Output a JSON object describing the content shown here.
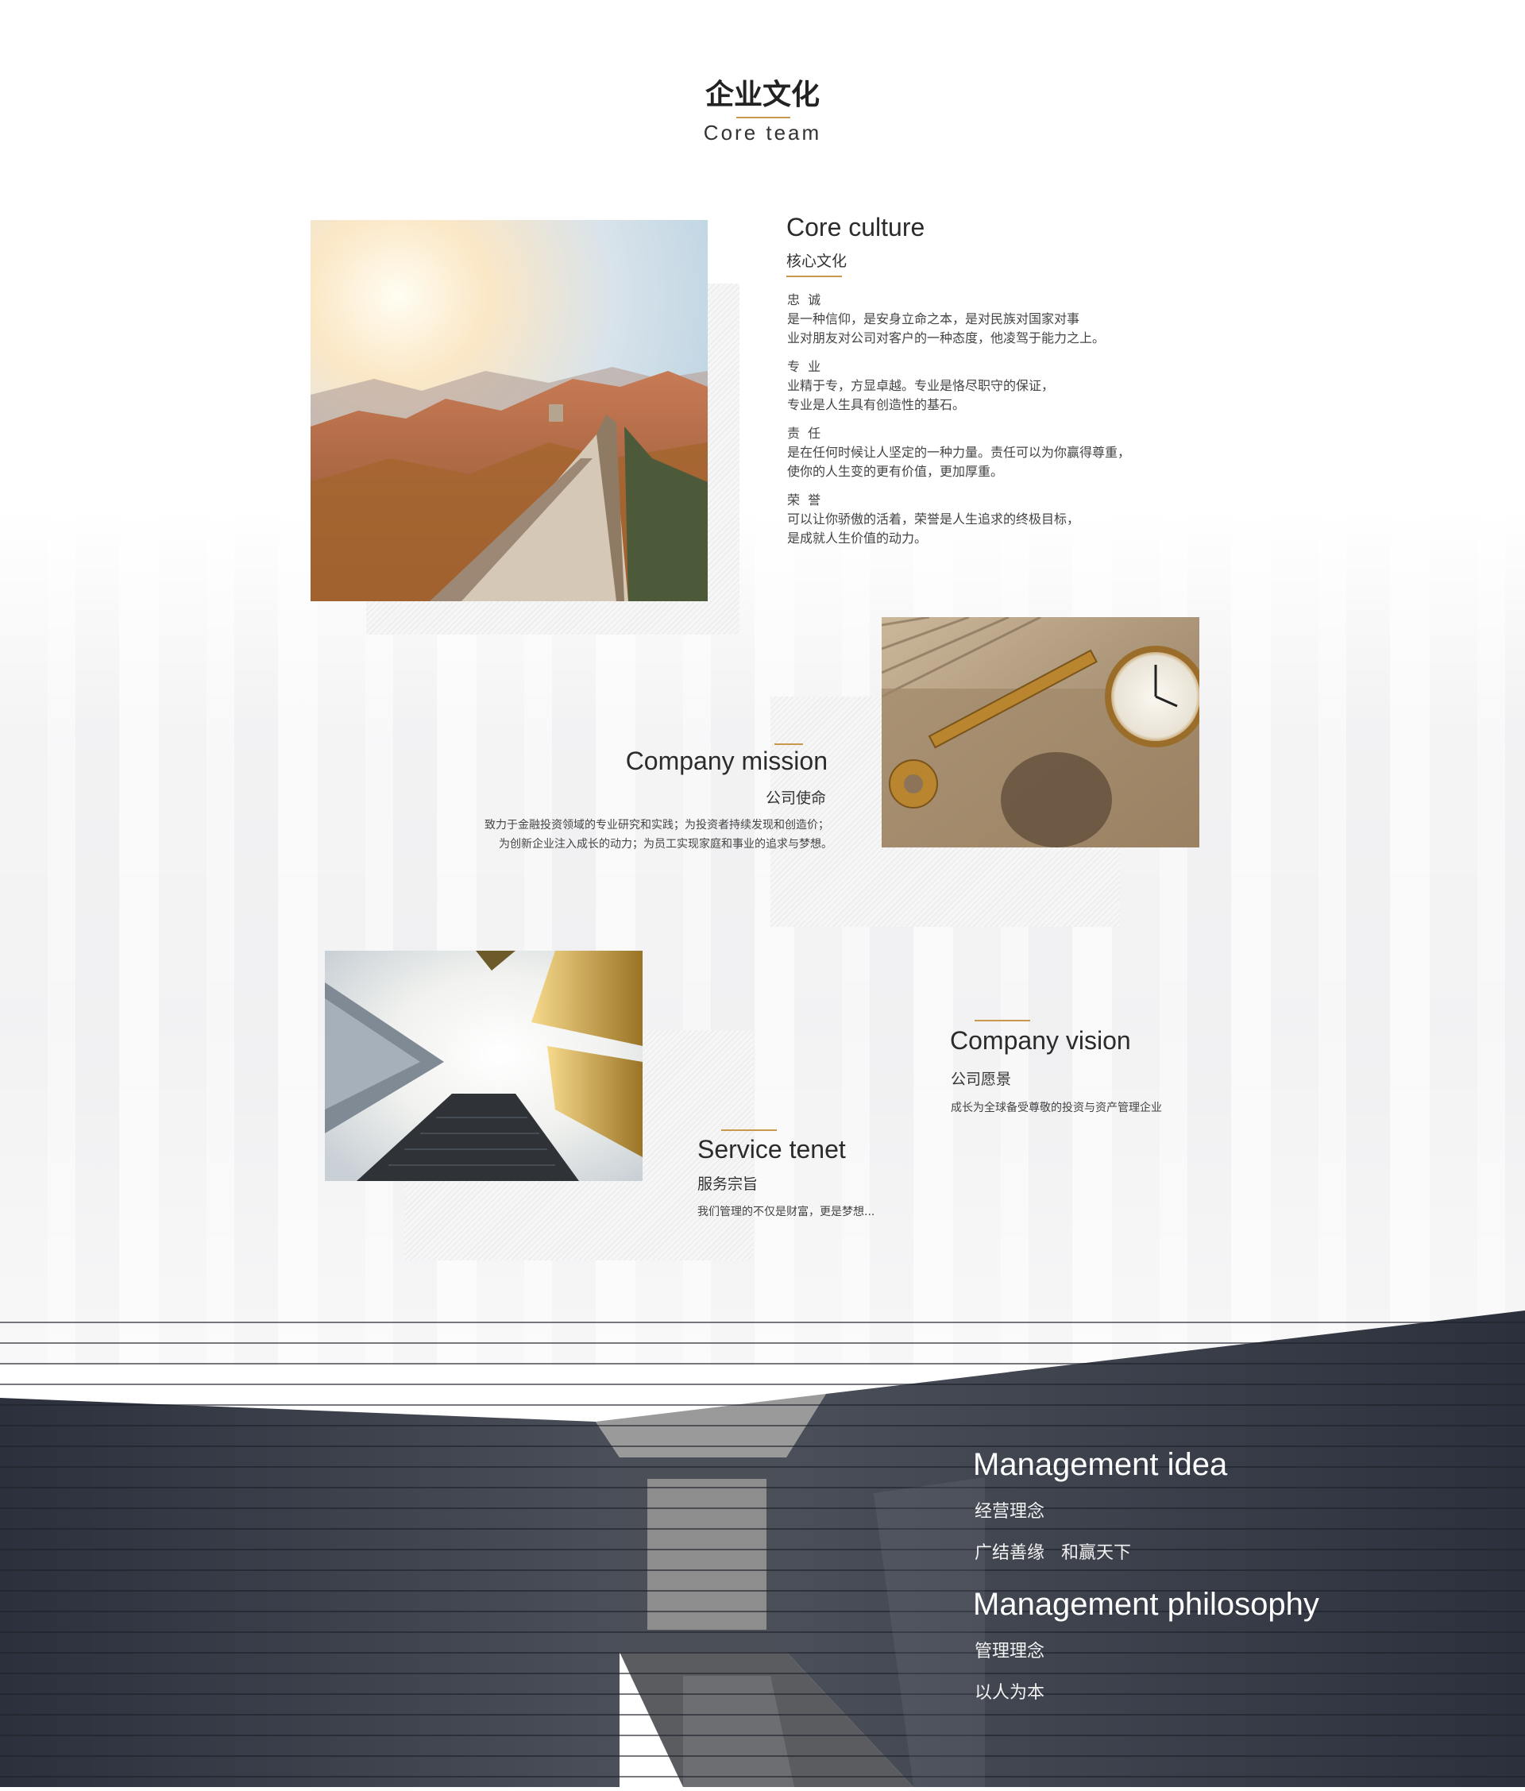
{
  "header": {
    "title_cn": "企业文化",
    "title_en": "Core team"
  },
  "core_culture": {
    "title_en": "Core culture",
    "title_cn": "核心文化",
    "items": [
      {
        "heading": "忠  诚",
        "line1": "是一种信仰，是安身立命之本，是对民族对国家对事",
        "line2": "业对朋友对公司对客户的一种态度，他凌驾于能力之上。"
      },
      {
        "heading": "专  业",
        "line1": "业精于专，方显卓越。专业是恪尽职守的保证，",
        "line2": "专业是人生具有创造性的基石。"
      },
      {
        "heading": "责  任",
        "line1": "是在任何时候让人坚定的一种力量。责任可以为你赢得尊重，",
        "line2": "使你的人生变的更有价值，更加厚重。"
      },
      {
        "heading": "荣  誉",
        "line1": "可以让你骄傲的活着，荣誉是人生追求的终极目标，",
        "line2": "是成就人生价值的动力。"
      }
    ]
  },
  "mission": {
    "title_en": "Company mission",
    "title_cn": "公司使命",
    "line1": "致力于金融投资领域的专业研究和实践；为投资者持续发现和创造价；",
    "line2": "为创新企业注入成长的动力；为员工实现家庭和事业的追求与梦想。"
  },
  "vision": {
    "title_en": "Company vision",
    "title_cn": "公司愿景",
    "text": "成长为全球备受尊敬的投资与资产管理企业"
  },
  "tenet": {
    "title_en": "Service tenet",
    "title_cn": "服务宗旨",
    "text": "我们管理的不仅是财富，更是梦想..."
  },
  "management_idea": {
    "title_en": "Management idea",
    "title_cn": "经营理念",
    "text": "广结善缘   和赢天下"
  },
  "management_philosophy": {
    "title_en": "Management philosophy",
    "title_cn": "管理理念",
    "text": "以人为本"
  },
  "colors": {
    "accent": "#c9984f",
    "dark": "#2e3340"
  }
}
